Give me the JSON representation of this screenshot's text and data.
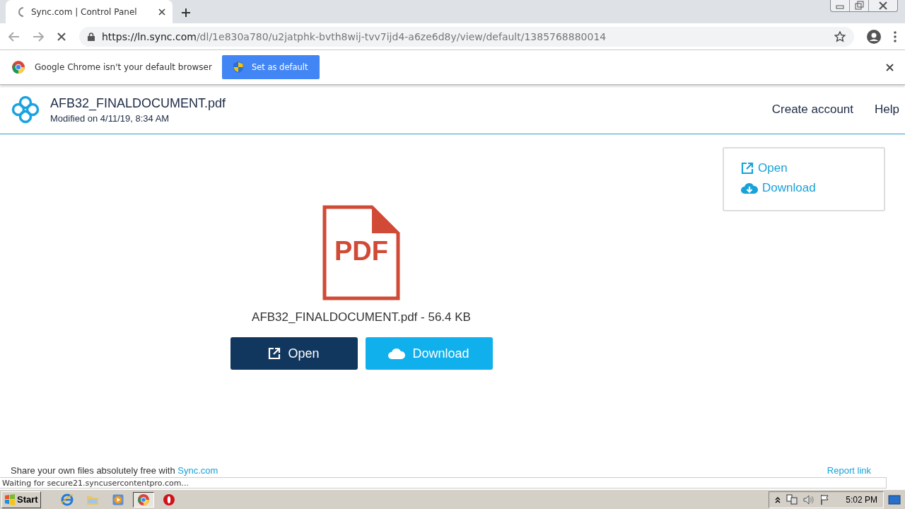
{
  "browser": {
    "tab": {
      "title": "Sync.com | Control Panel",
      "loading": true
    },
    "url": {
      "host": "https://ln.sync.com",
      "path": "/dl/1e830a780/u2jatphk-bvth8wij-tvv7ijd4-a6ze6d8y/view/default/1385768880014"
    }
  },
  "infobar": {
    "message": "Google Chrome isn't your default browser",
    "button": "Set as default"
  },
  "header": {
    "file_name": "AFB32_FINALDOCUMENT.pdf",
    "modified": "Modified on 4/11/19, 8:34 AM",
    "links": [
      "Create account",
      "Help"
    ]
  },
  "side_menu": [
    {
      "kind": "open",
      "label": "Open"
    },
    {
      "kind": "download",
      "label": "Download"
    }
  ],
  "file": {
    "icon_label": "PDF",
    "caption": "AFB32_FINALDOCUMENT.pdf - 56.4 KB",
    "buttons": [
      {
        "kind": "open",
        "label": "Open"
      },
      {
        "kind": "download",
        "label": "Download"
      }
    ]
  },
  "footer": {
    "text": "Share your own files absolutely free with ",
    "link": "Sync.com",
    "report": "Report link"
  },
  "status_bubble": "Waiting for secure21.syncusercontentpro.com...",
  "taskbar": {
    "start": "Start",
    "apps": [
      {
        "kind": "ie",
        "active": false
      },
      {
        "kind": "folder",
        "active": false
      },
      {
        "kind": "media",
        "active": false
      },
      {
        "kind": "chrome",
        "active": true
      },
      {
        "kind": "opera",
        "active": false
      }
    ],
    "clock": "5:02 PM"
  }
}
